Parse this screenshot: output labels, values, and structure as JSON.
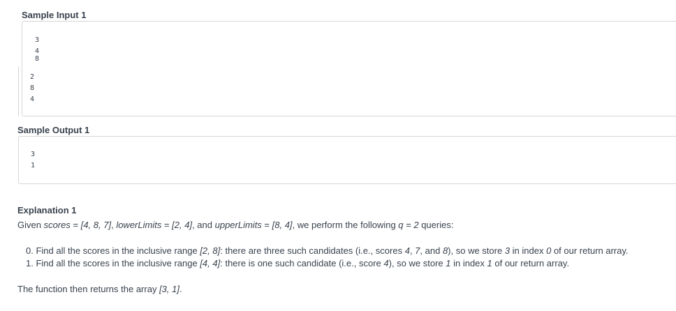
{
  "sample_input": {
    "heading": "Sample Input 1",
    "lines": [
      "3",
      "4",
      "8",
      "",
      "2",
      "8",
      "4"
    ]
  },
  "sample_output": {
    "heading": "Sample Output 1",
    "lines": [
      "3",
      "1"
    ]
  },
  "explanation": {
    "heading": "Explanation 1",
    "intro": {
      "p1": "Given ",
      "scores_name": "scores",
      "p2": " = ",
      "scores_val": "[4, 8, 7]",
      "p3": ", ",
      "lower_name": "lowerLimits",
      "p4": " = ",
      "lower_val": "[2, 4]",
      "p5": ", and ",
      "upper_name": "upperLimits",
      "p6": " = ",
      "upper_val": "[8, 4]",
      "p7": ", we perform the following ",
      "q_expr": "q = 2",
      "p8": " queries:"
    },
    "items": [
      {
        "num": "0.",
        "t1": " Find all the scores in the inclusive range ",
        "range": "[2, 8]",
        "t2": ": there are three such candidates (i.e., scores ",
        "s1": "4",
        "t3": ", ",
        "s2": "7",
        "t4": ", and ",
        "s3": "8",
        "t5": "), so we store ",
        "count": "3",
        "t6": " in index ",
        "index": "0",
        "t7": " of our return array."
      },
      {
        "num": "1.",
        "t1": " Find all the scores in the inclusive range ",
        "range": "[4, 4]",
        "t2": ": there is one such candidate (i.e., score ",
        "s1": "4",
        "t5": "), so we store ",
        "count": "1",
        "t6": " in index ",
        "index": "1",
        "t7": " of our return array."
      }
    ],
    "closing": {
      "p1": "The function then returns the array ",
      "arr": "[3, 1]",
      "p2": "."
    }
  }
}
